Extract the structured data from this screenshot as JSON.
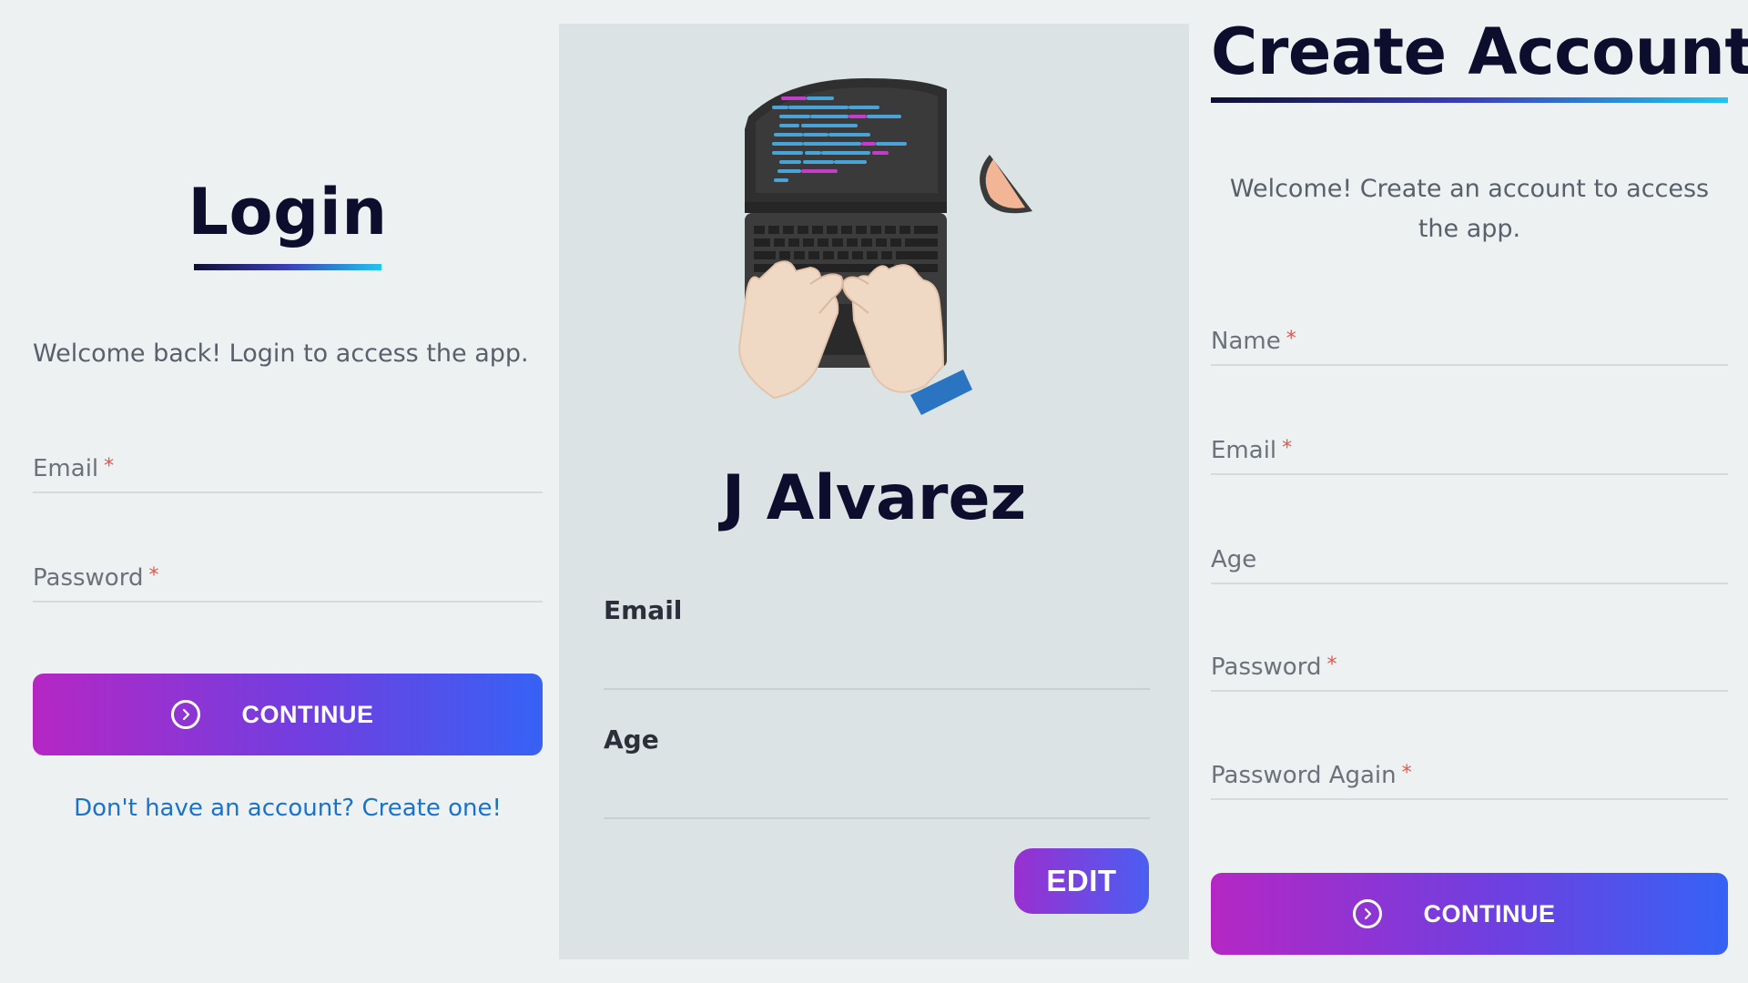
{
  "login": {
    "title": "Login",
    "welcome": "Welcome back! Login to access the app.",
    "fields": {
      "email_label": "Email",
      "password_label": "Password",
      "required_mark": "*"
    },
    "continue_label": "CONTINUE",
    "create_link": "Don't have an account? Create one!"
  },
  "profile": {
    "name": "J Alvarez",
    "email_label": "Email",
    "email_value": "",
    "age_label": "Age",
    "age_value": "",
    "edit_label": "EDIT"
  },
  "create": {
    "title": "Create Account",
    "welcome": "Welcome! Create an account to access the app.",
    "fields": {
      "name_label": "Name",
      "email_label": "Email",
      "age_label": "Age",
      "password_label": "Password",
      "password_again_label": "Password Again",
      "required_mark": "*"
    },
    "continue_label": "CONTINUE"
  },
  "icons": {
    "continue": "chevron-right-circle-icon",
    "illustration": "laptop-typing-illustration"
  },
  "colors": {
    "background": "#edf1f2",
    "profile_background": "#dce3e5",
    "title": "#0d0d2e",
    "link": "#1a73c9",
    "required": "#e0574f",
    "button_gradient_start": "#b527c4",
    "button_gradient_end": "#3662f5",
    "underline_start": "#0e0e34",
    "underline_end": "#1fc6ef"
  }
}
